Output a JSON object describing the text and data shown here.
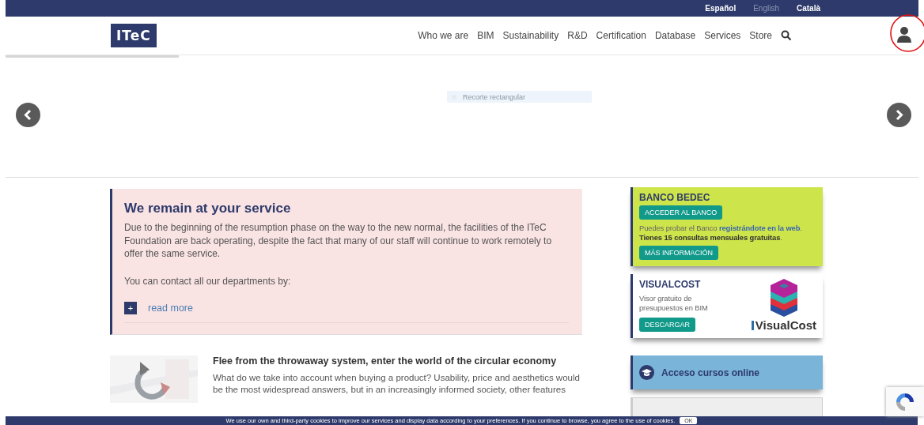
{
  "languages": [
    {
      "label": "Español",
      "selected": false
    },
    {
      "label": "English",
      "selected": true
    },
    {
      "label": "Català",
      "selected": false
    }
  ],
  "logo": "ITeC",
  "nav": [
    "Who we are",
    "BIM",
    "Sustainability",
    "R&D",
    "Certification",
    "Database",
    "Services",
    "Store"
  ],
  "carousel": {
    "level": 0.19,
    "snip_hint": "Recorte rectangular"
  },
  "notice": {
    "title": "We remain at your service",
    "paragraphs": [
      "Due to the beginning of the resumption phase on the way to the new normal, the facilities of the ITeC Foundation are back operating, despite the fact that many of our staff will continue to work remotely to offer the same service.",
      "You can contact all our departments by:"
    ],
    "expand": "+",
    "link": "read more"
  },
  "article": {
    "kind": "picture",
    "title": "Flee from the throwaway system, enter the world of the circular economy",
    "body": "What do we take into account when buying a product? Usability, price and aesthetics would be the most widespread answers, but in an increasingly informed society, other features"
  },
  "sidebar": [
    {
      "kind": "bank",
      "title": "BANCO BEDEC",
      "button": "ACCEDER AL BANCO",
      "text": "Puedes probar el Banco ",
      "link": "registrándote en la web",
      "text_end": ".",
      "strong": "Tienes 15 consultas mensuales gratuitas",
      "strong_end": ".",
      "button2": "MÁS INFORMACIÓN"
    },
    {
      "kind": "visualcost",
      "title": "VISUALCOST",
      "text": "Visor gratuito de presupuestos en BIM",
      "button": "DESCARGAR",
      "brand": "VisualCost"
    },
    {
      "kind": "courses",
      "title": "Acceso cursos online"
    },
    {
      "kind": "products"
    }
  ],
  "cookie": {
    "text": "We use our own and third-party cookies to improve our services and display data according to your preferences. If you continue to browse, you agree to the use of cookies.",
    "button": "OK"
  }
}
